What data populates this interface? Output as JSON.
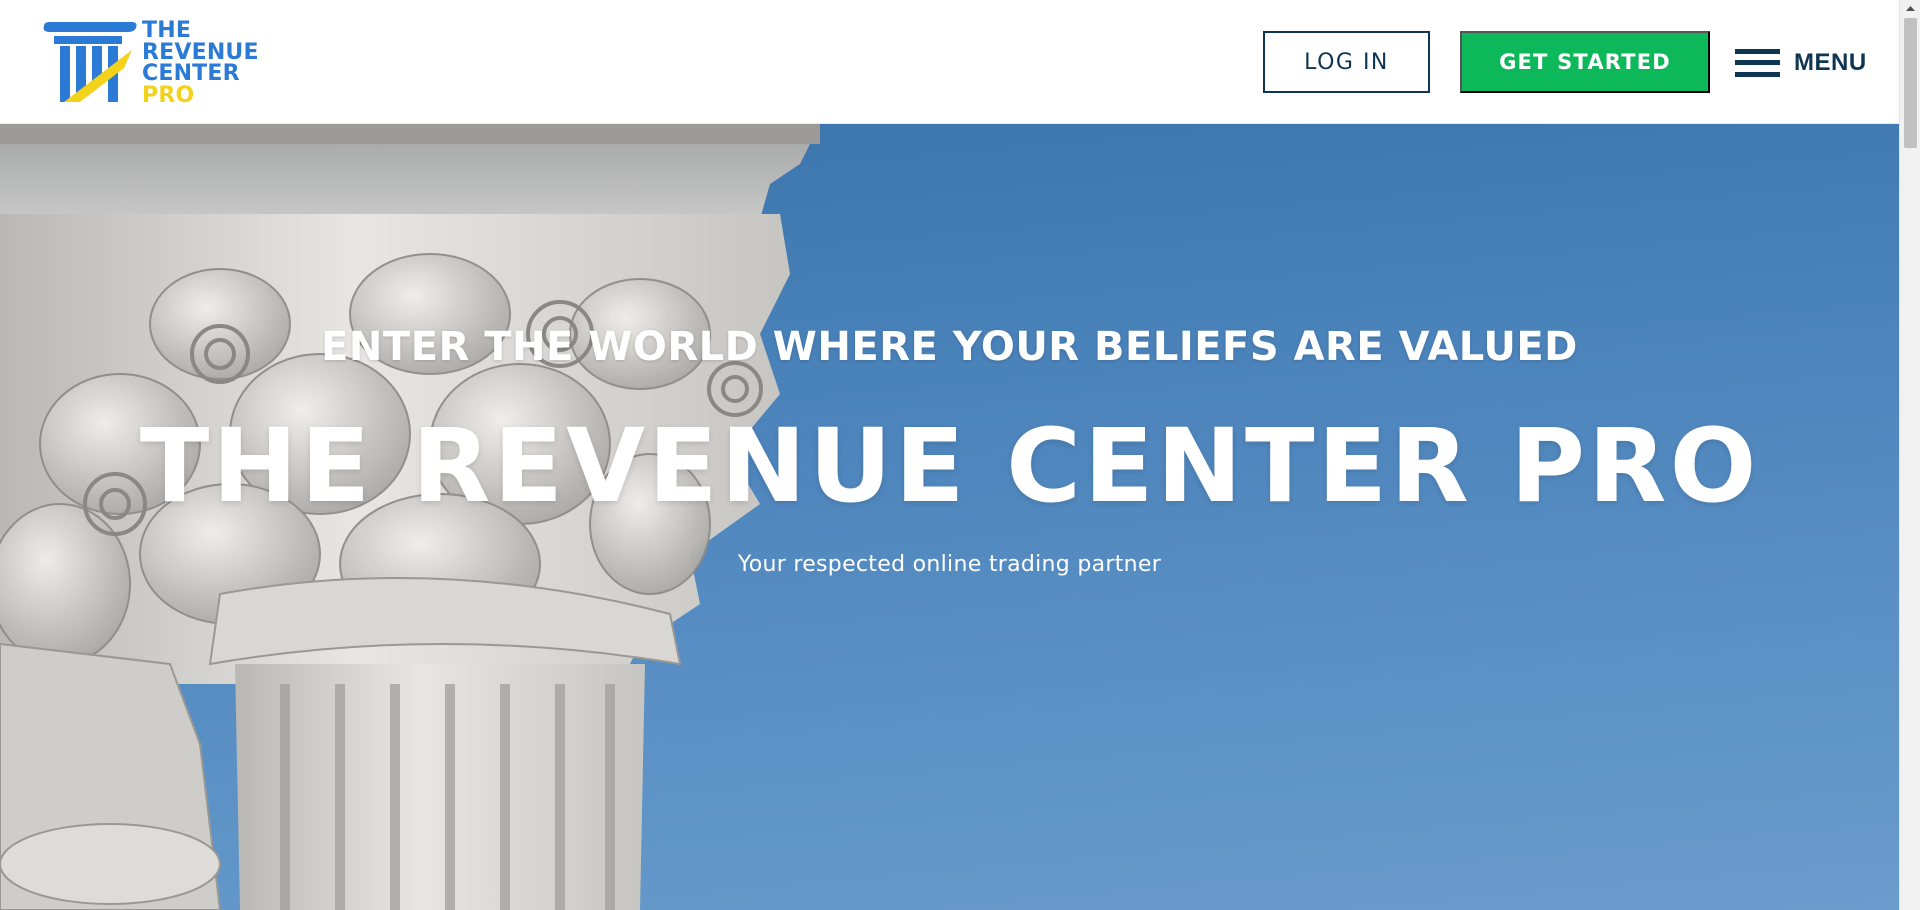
{
  "brand": {
    "logo_lines": [
      "THE",
      "REVENUE",
      "CENTER",
      "PRO"
    ],
    "colors": {
      "blue": "#2a7ad6",
      "yellow": "#f2d21a",
      "navy": "#0e3552"
    }
  },
  "header": {
    "login_label": "LOG IN",
    "get_started_label": "GET STARTED",
    "menu_label": "MENU",
    "colors": {
      "get_started_bg": "#0db85b"
    }
  },
  "hero": {
    "kicker": "ENTER THE WORLD WHERE YOUR BELIEFS ARE VALUED",
    "title": "THE REVENUE CENTER PRO",
    "subtitle": "Your respected online trading partner",
    "background_sky_color": "#4a82ba"
  },
  "icons": [
    "logo-column-icon",
    "hamburger-icon",
    "scroll-up-arrow-icon"
  ]
}
